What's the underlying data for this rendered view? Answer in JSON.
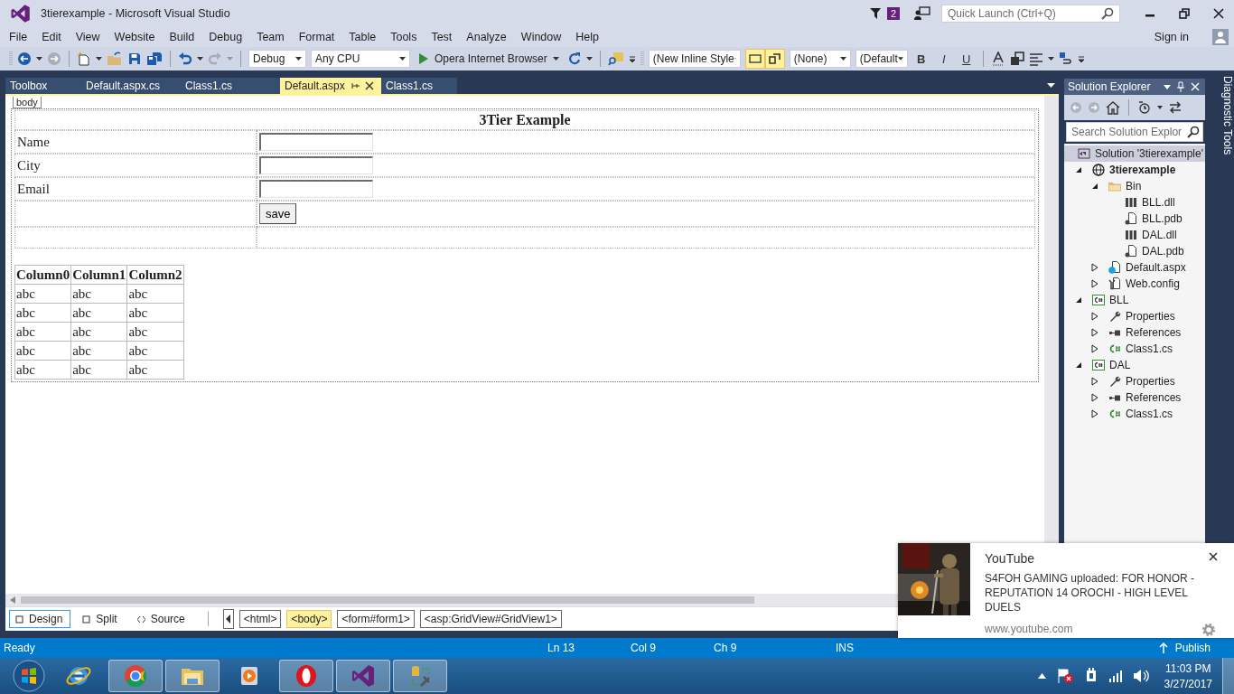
{
  "window": {
    "title": "3tierexample - Microsoft Visual Studio",
    "notifications": "2",
    "quick_launch": {
      "placeholder": "Quick Launch (Ctrl+Q)"
    }
  },
  "menu": [
    "File",
    "Edit",
    "View",
    "Website",
    "Build",
    "Debug",
    "Team",
    "Format",
    "Table",
    "Tools",
    "Test",
    "Analyze",
    "Window",
    "Help"
  ],
  "account": {
    "label": "Sign in"
  },
  "toolbar": {
    "configuration": "Debug",
    "platform": "Any CPU",
    "run_target": "Opera Internet Browser",
    "style_target": "(New Inline Style",
    "toggles": [
      {
        "on": true
      },
      {
        "on": true
      }
    ],
    "block_format": "(None)",
    "font": "(Default",
    "format_buttons": [
      {
        "label": "B",
        "kind": "bold"
      },
      {
        "label": "I",
        "kind": "italic"
      },
      {
        "label": "U",
        "kind": "underline"
      }
    ]
  },
  "tabs": [
    {
      "label": "Toolbox",
      "selected": false
    },
    {
      "label": "Default.aspx.cs",
      "selected": false
    },
    {
      "label": "Class1.cs",
      "selected": false
    },
    {
      "label": "Default.aspx",
      "selected": true
    },
    {
      "label": "Class1.cs",
      "selected": false
    }
  ],
  "designer": {
    "tag": "body",
    "title": "3Tier Example",
    "fields": [
      {
        "label": "Name"
      },
      {
        "label": "City"
      },
      {
        "label": "Email"
      }
    ],
    "button": "save",
    "grid": {
      "columns": [
        "Column0",
        "Column1",
        "Column2"
      ],
      "rows": [
        [
          "abc",
          "abc",
          "abc"
        ],
        [
          "abc",
          "abc",
          "abc"
        ],
        [
          "abc",
          "abc",
          "abc"
        ],
        [
          "abc",
          "abc",
          "abc"
        ],
        [
          "abc",
          "abc",
          "abc"
        ]
      ]
    }
  },
  "view_tabs": [
    {
      "label": "Design",
      "selected": true
    },
    {
      "label": "Split",
      "selected": false
    },
    {
      "label": "Source",
      "selected": false
    }
  ],
  "breadcrumb": [
    {
      "label": "<html>",
      "selected": false
    },
    {
      "label": "<body>",
      "selected": true
    },
    {
      "label": "<form#form1>",
      "selected": false
    },
    {
      "label": "<asp:GridView#GridView1>",
      "selected": false
    }
  ],
  "solution_explorer": {
    "title": "Solution Explorer",
    "search": {
      "placeholder": "Search Solution Explor"
    },
    "tree": [
      {
        "label": "Solution '3tierexample'",
        "kind": "solution",
        "selected": true,
        "children": [
          {
            "label": "3tierexample",
            "kind": "website",
            "selected": false,
            "expanded": true,
            "children": [
              {
                "label": "Bin",
                "kind": "folder",
                "selected": false,
                "expanded": true,
                "children": [
                  {
                    "label": "BLL.dll",
                    "kind": "dll",
                    "selected": false
                  },
                  {
                    "label": "BLL.pdb",
                    "kind": "pdb",
                    "selected": false
                  },
                  {
                    "label": "DAL.dll",
                    "kind": "dll",
                    "selected": false
                  },
                  {
                    "label": "DAL.pdb",
                    "kind": "pdb",
                    "selected": false
                  }
                ]
              },
              {
                "label": "Default.aspx",
                "kind": "aspx",
                "selected": false,
                "expanded": false
              },
              {
                "label": "Web.config",
                "kind": "config",
                "selected": false,
                "expanded": false
              }
            ]
          },
          {
            "label": "BLL",
            "kind": "csproj",
            "selected": false,
            "expanded": true,
            "children": [
              {
                "label": "Properties",
                "kind": "wrench",
                "selected": false,
                "expanded": false
              },
              {
                "label": "References",
                "kind": "refs",
                "selected": false,
                "expanded": false
              },
              {
                "label": "Class1.cs",
                "kind": "cs",
                "selected": false,
                "expanded": false
              }
            ]
          },
          {
            "label": "DAL",
            "kind": "csproj",
            "selected": false,
            "expanded": true,
            "children": [
              {
                "label": "Properties",
                "kind": "wrench",
                "selected": false,
                "expanded": false
              },
              {
                "label": "References",
                "kind": "refs",
                "selected": false,
                "expanded": false
              },
              {
                "label": "Class1.cs",
                "kind": "cs",
                "selected": false,
                "expanded": false
              }
            ]
          }
        ]
      }
    ]
  },
  "side_tab": "Diagnostic Tools",
  "status_bar": {
    "state": "Ready",
    "line": "Ln 13",
    "column": "Col 9",
    "char": "Ch 9",
    "mode": "INS",
    "publish": "Publish"
  },
  "notification": {
    "app": "YouTube",
    "message": "S4FOH GAMING uploaded: FOR HONOR - REPUTATION 14 OROCHI - HIGH LEVEL DUELS",
    "source": "www.youtube.com"
  },
  "taskbar": {
    "apps": [
      {
        "kind": "ie",
        "running": false
      },
      {
        "kind": "chrome",
        "running": true
      },
      {
        "kind": "explorer",
        "running": true
      },
      {
        "kind": "media",
        "running": false
      },
      {
        "kind": "opera",
        "running": true
      },
      {
        "kind": "vs",
        "running": true
      },
      {
        "kind": "tool",
        "running": true
      }
    ],
    "clock": {
      "time": "11:03 PM",
      "date": "3/27/2017"
    }
  }
}
